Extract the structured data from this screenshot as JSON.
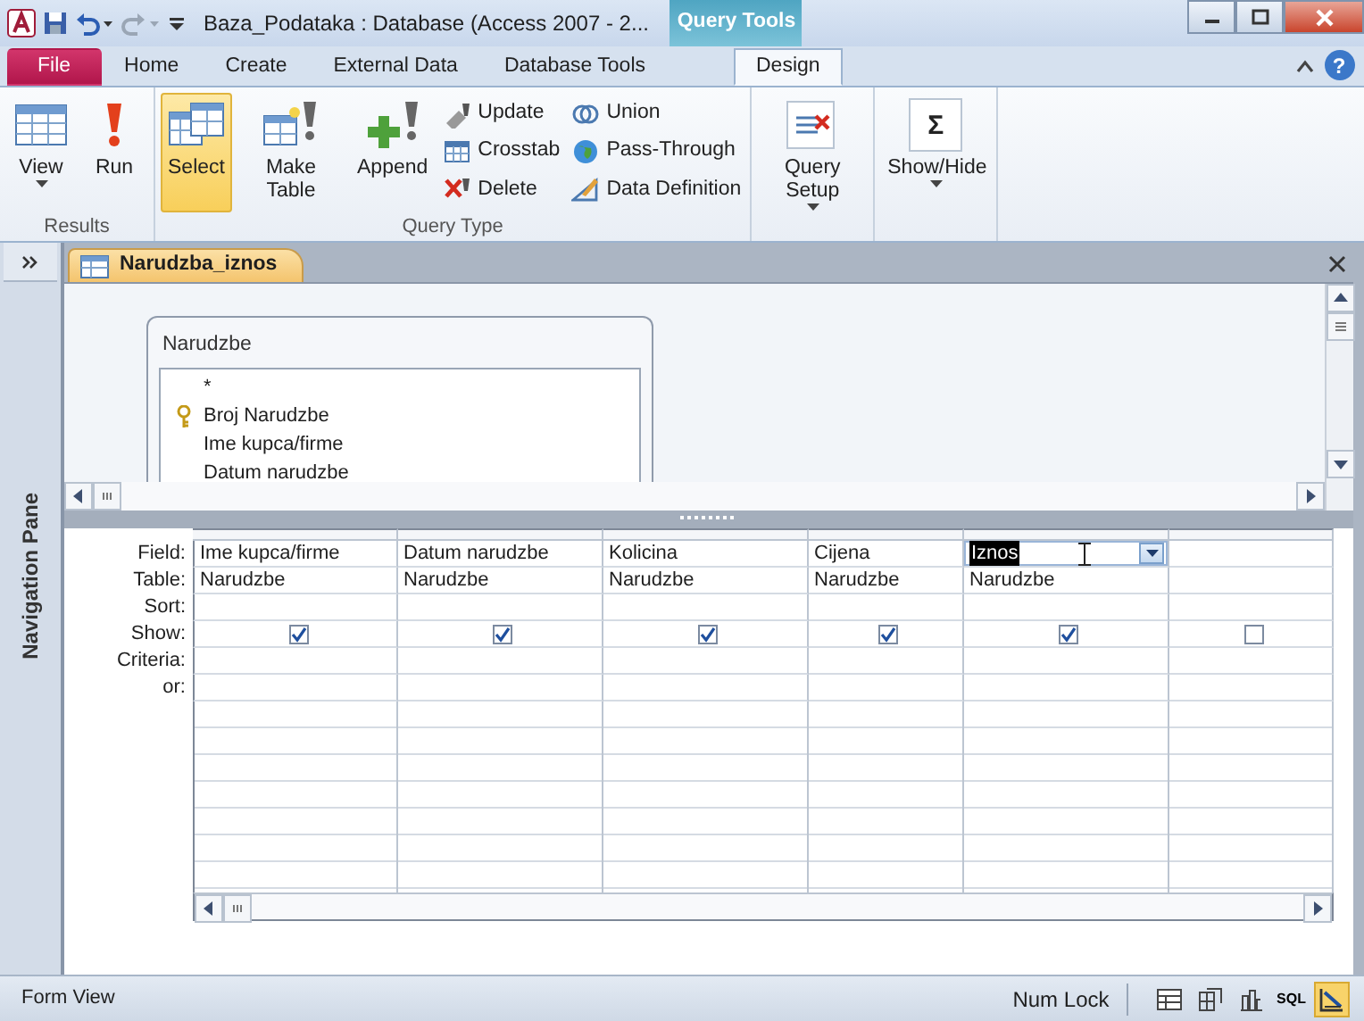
{
  "title_bar": {
    "title": "Baza_Podataka : Database (Access 2007 - 2...",
    "context_label": "Query Tools",
    "help": "?"
  },
  "ribbon_tabs": [
    {
      "label": "File",
      "kind": "file",
      "selected": false
    },
    {
      "label": "Home",
      "kind": "tab",
      "selected": false
    },
    {
      "label": "Create",
      "kind": "tab",
      "selected": false
    },
    {
      "label": "External Data",
      "kind": "tab",
      "selected": false
    },
    {
      "label": "Database Tools",
      "kind": "tab",
      "selected": false
    },
    {
      "label": "Design",
      "kind": "tab",
      "selected": true
    }
  ],
  "ribbon_groups": [
    {
      "label": "Results",
      "buttons": [
        {
          "kind": "large",
          "label": "View",
          "dropdown": true,
          "selected": false
        },
        {
          "kind": "large",
          "label": "Run",
          "selected": false
        }
      ]
    },
    {
      "label": "Query Type",
      "buttons": [
        {
          "kind": "large",
          "label": "Select",
          "selected": true
        },
        {
          "kind": "large",
          "label": "Make Table",
          "selected": false
        },
        {
          "kind": "large",
          "label": "Append",
          "selected": false
        },
        {
          "kind": "small",
          "label": "Update"
        },
        {
          "kind": "small",
          "label": "Crosstab"
        },
        {
          "kind": "small",
          "label": "Delete"
        },
        {
          "kind": "small",
          "label": "Union"
        },
        {
          "kind": "small",
          "label": "Pass-Through"
        },
        {
          "kind": "small",
          "label": "Data Definition"
        }
      ]
    },
    {
      "buttons": [
        {
          "kind": "large",
          "label": "Query Setup",
          "dropdown": true,
          "selected": false
        }
      ]
    },
    {
      "buttons": [
        {
          "kind": "large",
          "label": "Show/Hide",
          "icon_text": "Σ",
          "dropdown": true,
          "selected": false
        }
      ]
    }
  ],
  "navigation_pane": {
    "label": "Navigation Pane"
  },
  "document": {
    "tab": "Narudzba_iznos",
    "table_box": {
      "title": "Narudzbe",
      "fields": [
        {
          "label": "*",
          "key": false
        },
        {
          "label": "Broj Narudzbe",
          "key": true
        },
        {
          "label": "Ime kupca/firme",
          "key": false
        },
        {
          "label": "Datum narudzbe",
          "key": false
        }
      ]
    }
  },
  "grid": {
    "row_labels": [
      "Field:",
      "Table:",
      "Sort:",
      "Show:",
      "Criteria:",
      "or:"
    ],
    "columns": [
      {
        "field": "Ime kupca/firme",
        "table": "Narudzbe",
        "show": true,
        "selected": false
      },
      {
        "field": "Datum narudzbe",
        "table": "Narudzbe",
        "show": true,
        "selected": false
      },
      {
        "field": "Kolicina",
        "table": "Narudzbe",
        "show": true,
        "selected": false
      },
      {
        "field": "Cijena",
        "table": "Narudzbe",
        "show": true,
        "selected": false
      },
      {
        "field": "Iznos",
        "table": "Narudzbe",
        "show": true,
        "selected": true
      },
      {
        "show": false,
        "selected": false
      }
    ]
  },
  "status_bar": {
    "view_name": "Form View",
    "indicator": "Num Lock",
    "views": [
      {
        "kind": "datasheet",
        "selected": false
      },
      {
        "kind": "pivottable",
        "selected": false
      },
      {
        "kind": "pivotchart",
        "selected": false
      },
      {
        "kind": "sql",
        "label": "SQL",
        "selected": false
      },
      {
        "kind": "design",
        "selected": true
      }
    ]
  }
}
